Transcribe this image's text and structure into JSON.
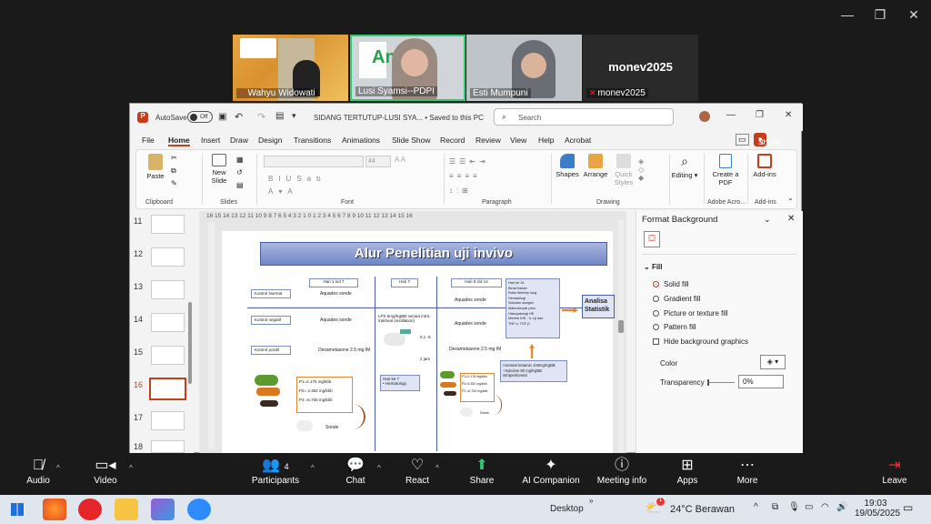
{
  "zoom": {
    "participants_tiles": [
      {
        "name": "Wahyu Widowati",
        "muted": true
      },
      {
        "name": "Lusi Syamsi--PDPI",
        "muted": false
      },
      {
        "name": "Esti Mumpuni",
        "muted": false
      },
      {
        "name": "monev2025",
        "muted": true,
        "label": "monev2025"
      }
    ],
    "toolbar": {
      "audio": "Audio",
      "video": "Video",
      "participants": "Participants",
      "participants_count": "4",
      "chat": "Chat",
      "react": "React",
      "share": "Share",
      "ai_companion": "AI Companion",
      "meeting_info": "Meeting info",
      "apps": "Apps",
      "more": "More",
      "leave": "Leave"
    }
  },
  "ppt": {
    "autosave": "AutoSave",
    "autosave_state": "Off",
    "doc_title": "SIDANG TERTUTUP-LUSI SYA... • Saved to this PC",
    "search_placeholder": "Search",
    "menu": [
      "File",
      "Home",
      "Insert",
      "Draw",
      "Design",
      "Transitions",
      "Animations",
      "Slide Show",
      "Record",
      "Review",
      "View",
      "Help",
      "Acrobat"
    ],
    "active_menu": "Home",
    "share_label": "Share",
    "ribbon": {
      "paste": "Paste",
      "clipboard": "Clipboard",
      "new_slide": "New Slide",
      "slides": "Slides",
      "font": "Font",
      "font_size": "44",
      "paragraph": "Paragraph",
      "shapes": "Shapes",
      "arrange": "Arrange",
      "quick_styles": "Quick Styles",
      "drawing": "Drawing",
      "editing": "Editing",
      "create_pdf": "Create a PDF",
      "adobe_acrobat": "Adobe Acro...",
      "addins": "Add-ins",
      "addins_group": "Add-ins"
    },
    "ruler": "16 15 14 13 12 11 10 9 8 7 6 5 4 3 2 1 0 1 2 3 4 5 6 7 8 9 10 11 12 13 14 15 16",
    "thumb_numbers": [
      "11",
      "12",
      "13",
      "14",
      "15",
      "16",
      "17",
      "18"
    ],
    "active_thumb": "16",
    "slide": {
      "title": "Alur Penelitian uji invivo",
      "groups": [
        "Kontrol Normal",
        "Kontrol negatif",
        "Kontrol positif"
      ],
      "days": [
        "Hari 1 s/d 7",
        "Hari 7",
        "Hari 8 s/d 14"
      ],
      "aquades1": "Aquades sonde",
      "aquades2": "Aquades sonde",
      "aquades3": "Aquades sonde",
      "aquades4": "Aquades sonde",
      "dexa1": "Dexametasone 2.5 mg IM",
      "dexa2": "Dexametasone 2.5 mg IM",
      "lps": "LPS 5mg/KgBB secara intra-trakheal (instillation)",
      "lps_time1": "0,1 -6",
      "lps_time2": "2 jam",
      "hari7_box": "Hari ke 7",
      "hari7_item": "Hematologi",
      "doses": [
        "P1=2.176 mg/kbb",
        "P2= 4.352 mg/kbb",
        "P3 =6.705 mg/kbb"
      ],
      "doses_small": [
        "P1=2.176 mg/kbb",
        "P2=4.352 mg/kbb",
        "P3 =6.705 mg/kbb"
      ],
      "sonde1": "Sonde",
      "sonde2": "Sonde",
      "hari14_list": [
        "Hari ke 14",
        "Berat badan",
        "Ratio Wet/dry lung",
        "Hematologi",
        "Saturasi oksigen",
        "Makroskopik paru",
        "Histopatologi HE",
        "Menilai IHK : IL 1β dan",
        "TNF α, TGF β"
      ],
      "anestesi": "Anestesi ketamin 100mg/KgBB +Xylazine 80 mg/KgBB intraperitoneal",
      "analisa": "Analisa Statistik"
    },
    "format_bg": {
      "title": "Format Background",
      "fill": "Fill",
      "options": [
        "Solid fill",
        "Gradient fill",
        "Picture or texture fill",
        "Pattern fill"
      ],
      "selected": "Solid fill",
      "hide_bg": "Hide background graphics",
      "color": "Color",
      "transparency": "Transparency",
      "transparency_value": "0%"
    }
  },
  "taskbar": {
    "desktop": "Desktop",
    "weather": "24°C  Berawan",
    "time": "19:03",
    "date": "19/05/2025",
    "notif_count": "1"
  }
}
